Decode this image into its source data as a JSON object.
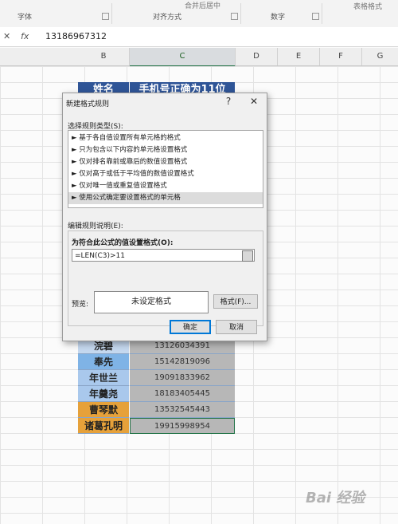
{
  "ribbon": {
    "groups": [
      "字体",
      "对齐方式",
      "数字"
    ],
    "partial_items": [
      "合并后居中",
      "表格格式"
    ]
  },
  "formula_bar": {
    "cancel_icon": "cross-icon",
    "fx": "fx",
    "value": "13186967312"
  },
  "columns": [
    "B",
    "C",
    "D",
    "E",
    "F",
    "G"
  ],
  "table": {
    "header_name": "姓名",
    "header_phone": "手机号正确为11位",
    "rows": [
      {
        "name": "浣碧",
        "phone": "13126034391",
        "color": "#c5d8ef"
      },
      {
        "name": "奉先",
        "phone": "15142819096",
        "color": "#7fb3e6"
      },
      {
        "name": "年世兰",
        "phone": "19091833962",
        "color": "#a9c8ec"
      },
      {
        "name": "年羹尧",
        "phone": "18183405445",
        "color": "#a9c8ec"
      },
      {
        "name": "曹琴默",
        "phone": "13532545443",
        "color": "#e6a13a"
      },
      {
        "name": "诸葛孔明",
        "phone": "19915998954",
        "color": "#e6a13a"
      }
    ]
  },
  "dialog": {
    "title": "新建格式规则",
    "help": "?",
    "close": "✕",
    "select_type_label": "选择规则类型(S):",
    "rule_types": [
      "► 基于各自值设置所有单元格的格式",
      "► 只为包含以下内容的单元格设置格式",
      "► 仅对排名靠前或靠后的数值设置格式",
      "► 仅对高于或低于平均值的数值设置格式",
      "► 仅对唯一值或重复值设置格式",
      "► 使用公式确定要设置格式的单元格"
    ],
    "edit_label": "编辑规则说明(E):",
    "formula_label": "为符合此公式的值设置格式(O):",
    "formula_value": "=LEN(C3)>11",
    "preview_label": "预览:",
    "preview_text": "未设定格式",
    "format_button": "格式(F)...",
    "ok_button": "确定",
    "cancel_button": "取消"
  },
  "watermark": "Bai 经验"
}
